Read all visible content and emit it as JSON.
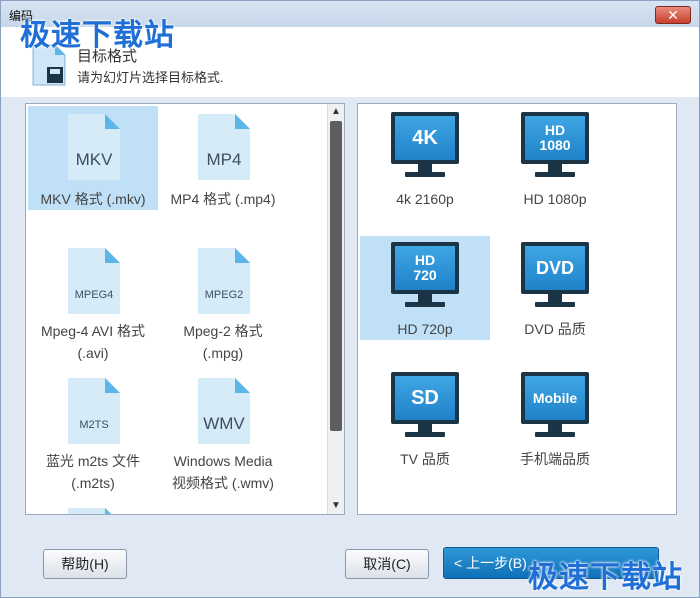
{
  "window": {
    "title": "编码"
  },
  "watermark": {
    "text": "极速下载站"
  },
  "header": {
    "title": "目标格式",
    "subtitle": "请为幻灯片选择目标格式."
  },
  "left_panel": {
    "items": [
      {
        "icon_text": "MKV",
        "label": "MKV 格式 (.mkv)",
        "selected": true
      },
      {
        "icon_text": "MP4",
        "label": "MP4 格式 (.mp4)",
        "selected": false
      },
      {
        "icon_text": "MPEG4",
        "label_line1": "Mpeg-4 AVI 格式",
        "label_line2": "(.avi)",
        "selected": false
      },
      {
        "icon_text": "MPEG2",
        "label_line1": "Mpeg-2 格式",
        "label_line2": "(.mpg)",
        "selected": false
      },
      {
        "icon_text": "M2TS",
        "label_line1": "蓝光 m2ts 文件",
        "label_line2": "(.m2ts)",
        "selected": false
      },
      {
        "icon_text": "WMV",
        "label_line1": "Windows Media",
        "label_line2": "视频格式 (.wmv)",
        "selected": false
      }
    ]
  },
  "right_panel": {
    "items": [
      {
        "screen_line1": "4K",
        "screen_line2": "",
        "label": "4k 2160p",
        "selected": false
      },
      {
        "screen_line1": "HD",
        "screen_line2": "1080",
        "label": "HD 1080p",
        "selected": false
      },
      {
        "screen_line1": "HD",
        "screen_line2": "720",
        "label": "HD 720p",
        "selected": true
      },
      {
        "screen_line1": "DVD",
        "screen_line2": "",
        "label": "DVD 品质",
        "selected": false
      },
      {
        "screen_line1": "SD",
        "screen_line2": "",
        "label": "TV 品质",
        "selected": false
      },
      {
        "screen_line1": "Mobile",
        "screen_line2": "",
        "label": "手机端品质",
        "selected": false
      }
    ]
  },
  "scrollbar": {
    "up_glyph": "▲",
    "down_glyph": "▼"
  },
  "buttons": {
    "help": "帮助(H)",
    "cancel": "取消(C)",
    "back": "< 上一步(B)"
  },
  "colors": {
    "accent": "#1f82c9",
    "selection": "#bfe0f7",
    "watermark": "#1f6fd6"
  }
}
